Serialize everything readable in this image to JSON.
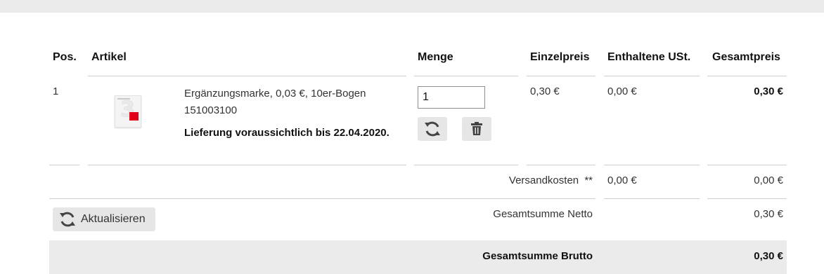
{
  "table": {
    "headers": {
      "pos": "Pos.",
      "artikel": "Artikel",
      "menge": "Menge",
      "einzelpreis": "Einzelpreis",
      "ust": "Enthaltene USt.",
      "gesamtpreis": "Gesamtpreis"
    },
    "rows": [
      {
        "pos": "1",
        "title": "Ergänzungsmarke, 0,03 €, 10er-Bogen",
        "article_number": "151003100",
        "delivery": "Lieferung voraussichtlich bis 22.04.2020.",
        "quantity": "1",
        "unit_price": "0,30 €",
        "vat": "0,00 €",
        "total": "0,30 €"
      }
    ]
  },
  "shipping": {
    "label": "Versandkosten",
    "marker": "**",
    "vat": "0,00 €",
    "total": "0,00 €"
  },
  "update_button": {
    "label": "Aktualisieren"
  },
  "net_total": {
    "label": "Gesamtsumme Netto",
    "value": "0,30 €"
  },
  "gross_total": {
    "label": "Gesamtsumme Brutto",
    "value": "0,30 €"
  },
  "icons": {
    "refresh": "refresh-icon",
    "delete": "trash-icon",
    "product": "stamp-thumbnail"
  }
}
